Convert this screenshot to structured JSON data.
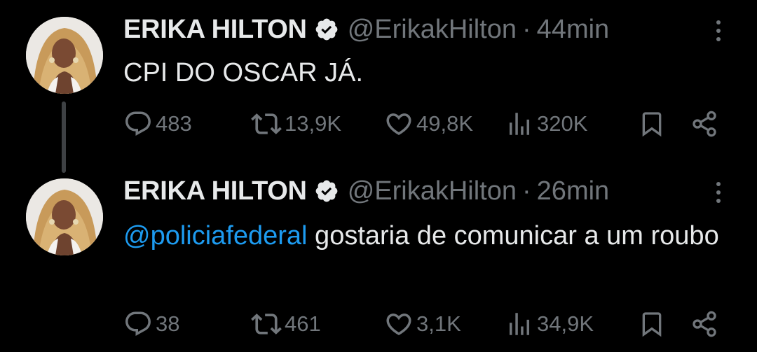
{
  "tweets": [
    {
      "author_name": "ERIKA HILTON",
      "handle": "@ErikakHilton",
      "separator": "·",
      "time": "44min",
      "text": "CPI DO OSCAR JÁ.",
      "mention": "",
      "replies": "483",
      "retweets": "13,9K",
      "likes": "49,8K",
      "views": "320K"
    },
    {
      "author_name": "ERIKA HILTON",
      "handle": "@ErikakHilton",
      "separator": "·",
      "time": "26min",
      "text": " gostaria de comunicar a um roubo",
      "mention": "@policiafederal",
      "replies": "38",
      "retweets": "461",
      "likes": "3,1K",
      "views": "34,9K"
    }
  ],
  "icons": {
    "verified": "verified-badge-icon",
    "more": "more-options-icon",
    "reply": "reply-icon",
    "retweet": "retweet-icon",
    "like": "heart-icon",
    "views": "views-icon",
    "bookmark": "bookmark-icon",
    "share": "share-icon"
  },
  "colors": {
    "background": "#000000",
    "primary_text": "#e7e9ea",
    "secondary_text": "#71767b",
    "link": "#1d9bf0",
    "thread_line": "#3e4144"
  }
}
